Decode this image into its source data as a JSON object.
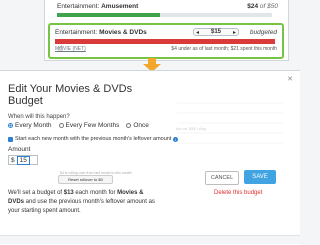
{
  "top": {
    "category": "Entertainment:",
    "subcategory": "Amusement",
    "amount": "$24",
    "of_label": "of $50",
    "fill": 0.48
  },
  "selected": {
    "category": "Entertainment:",
    "subcategory": "Movies & DVDs",
    "stepper_value": "$15",
    "budgeted_label": "budgeted",
    "left_label": "MOVIE (NET)",
    "note": "$4 under as of last month; $21 spent this month"
  },
  "modal": {
    "title": "Edit Your Movies & DVDs Budget",
    "question": "When will this happen?",
    "options": [
      "Every Month",
      "Every Few Months",
      "Once"
    ],
    "selected_option": "Every Month",
    "rollover_check": "Start each new month with the previous month's leftover amount",
    "amount_label": "Amount",
    "currency": "$",
    "amount_value": "15",
    "rollover_note": "$4 is rolling over from last month to this month",
    "reset_label": "Reset rollover to $0",
    "summary_pre": "We'll set a budget of ",
    "summary_amount": "$13",
    "summary_mid": " each month for ",
    "summary_cat": "Movies & DVDs",
    "summary_post": " and use the previous month's leftover amount as your starting spent amount.",
    "legend": "You vs. $15 / Avg",
    "cancel": "CANCEL",
    "save": "SAVE",
    "delete": "Delete this budget"
  },
  "colors": {
    "accent": "#41a3e2",
    "danger": "#d9322f",
    "green": "#3fa34d",
    "red_bar": "#d93b3b",
    "selected_border": "#76c442"
  }
}
